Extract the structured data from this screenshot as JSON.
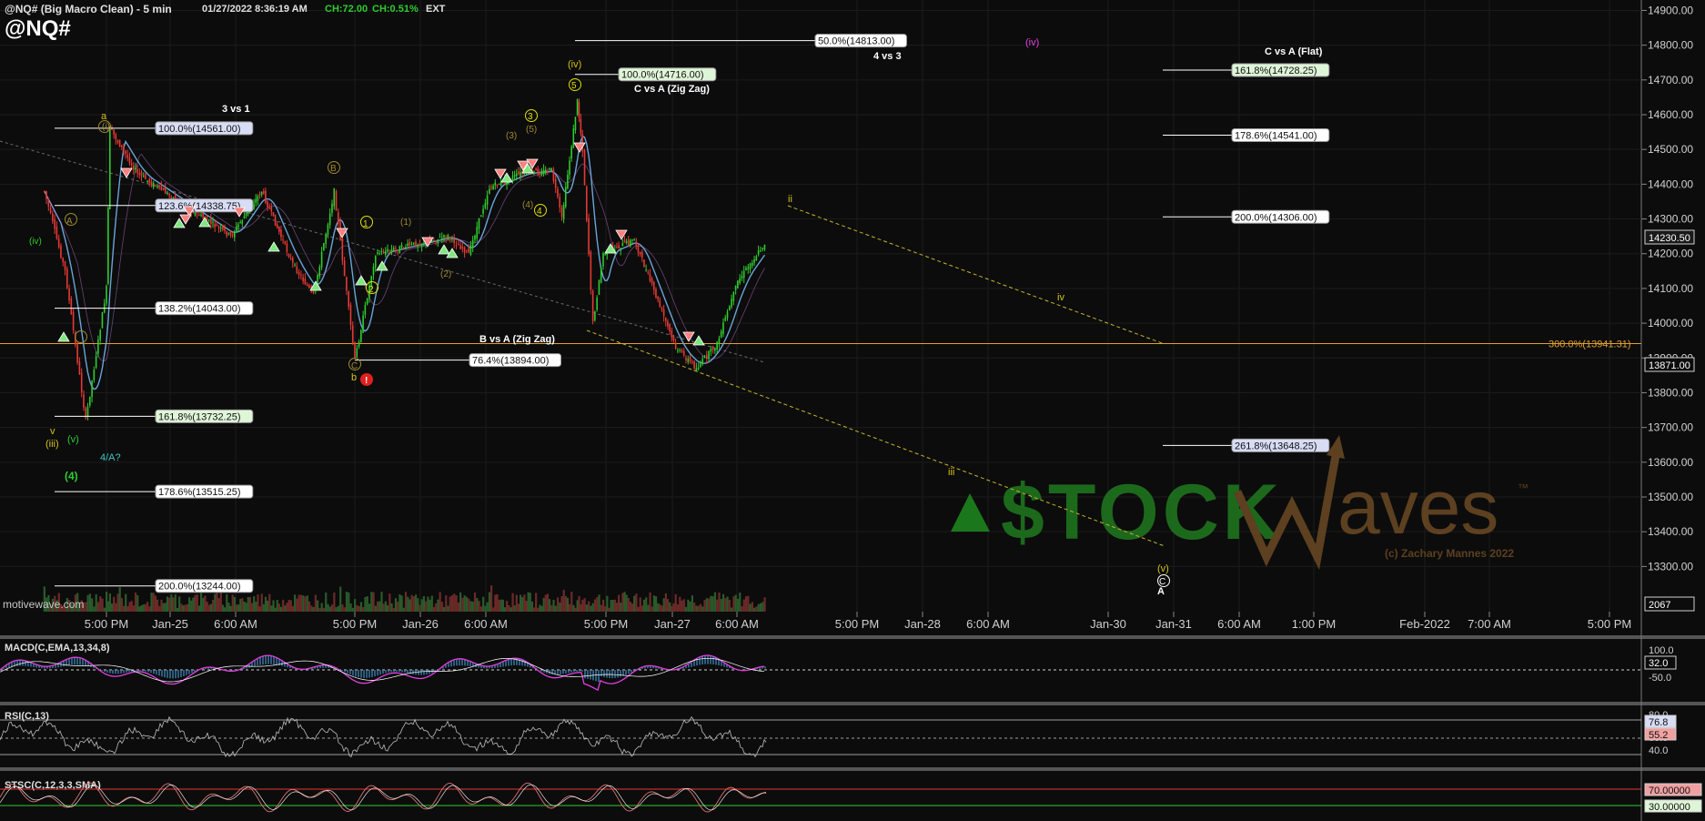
{
  "header": {
    "symbol_desc": "@NQ# (Big Macro Clean) - 5 min",
    "timestamp": "01/27/2022 8:36:19 AM",
    "ch": "CH:72.00",
    "ch_pct": "CH:0.51%",
    "session": "EXT",
    "symbol": "@NQ#"
  },
  "footer_text": "motivewave.com",
  "logo": {
    "text": "STOCKWaves",
    "tm": "™",
    "copyright": "(c) Zachary Mannes 2022"
  },
  "colors": {
    "background": "#0c0c0c",
    "up": "#2ecc2e",
    "down": "#e53935",
    "fib_box": "#ffffff",
    "orange_line": "#e0a030",
    "yellow_wave": "#d4c21a",
    "magenta": "#e040e0"
  },
  "chart_data": [
    {
      "type": "line",
      "title": "@NQ# 5 min",
      "y_axis_ticks": [
        "14900.00",
        "14800.00",
        "14700.00",
        "14600.00",
        "14500.00",
        "14400.00",
        "14300.00",
        "14200.00",
        "14100.00",
        "14000.00",
        "13900.00",
        "13800.00",
        "13700.00",
        "13600.00",
        "13500.00",
        "13400.00",
        "13300.00"
      ],
      "ylim": [
        13170,
        14930
      ],
      "price_tags": [
        "14230.50",
        "13871.00",
        "2067"
      ],
      "x_axis_ticks": [
        "5:00 PM",
        "Jan-25",
        "6:00 AM",
        "5:00 PM",
        "Jan-26",
        "6:00 AM",
        "5:00 PM",
        "Jan-27",
        "6:00 AM",
        "5:00 PM",
        "Jan-28",
        "6:00 AM",
        "Jan-30",
        "Jan-31",
        "6:00 AM",
        "1:00 PM",
        "Feb-2022",
        "7:00 AM",
        "5:00 PM"
      ],
      "price_path": [
        {
          "x": "Jan-24 11:00 AM",
          "y": 14380
        },
        {
          "x": "Jan-24 1:00 PM",
          "y": 14150
        },
        {
          "x": "Jan-24 3:00 PM",
          "y": 13720
        },
        {
          "x": "Jan-24 5:00 PM",
          "y": 14100
        },
        {
          "x": "Jan-24 5:20 PM",
          "y": 14560
        },
        {
          "x": "Jan-24 8:00 PM",
          "y": 14430
        },
        {
          "x": "Jan-25 1:00 AM",
          "y": 14330
        },
        {
          "x": "Jan-25 5:00 AM",
          "y": 14250
        },
        {
          "x": "Jan-25 8:00 AM",
          "y": 14380
        },
        {
          "x": "Jan-25 11:00 AM",
          "y": 14170
        },
        {
          "x": "Jan-25 1:00 PM",
          "y": 14080
        },
        {
          "x": "Jan-25 3:00 PM",
          "y": 14380
        },
        {
          "x": "Jan-25 5:00 PM",
          "y": 13894
        },
        {
          "x": "Jan-25 7:00 PM",
          "y": 14200
        },
        {
          "x": "Jan-26 2:00 AM",
          "y": 14250
        },
        {
          "x": "Jan-26 4:00 AM",
          "y": 14200
        },
        {
          "x": "Jan-26 6:00 AM",
          "y": 14390
        },
        {
          "x": "Jan-26 9:00 AM",
          "y": 14430
        },
        {
          "x": "Jan-26 12:00 PM",
          "y": 14440
        },
        {
          "x": "Jan-26 1:00 PM",
          "y": 14300
        },
        {
          "x": "Jan-26 2:30 PM",
          "y": 14640
        },
        {
          "x": "Jan-26 3:00 PM",
          "y": 14500
        },
        {
          "x": "Jan-26 4:00 PM",
          "y": 14000
        },
        {
          "x": "Jan-26 5:00 PM",
          "y": 14200
        },
        {
          "x": "Jan-26 8:00 PM",
          "y": 14240
        },
        {
          "x": "Jan-27 12:00 AM",
          "y": 13930
        },
        {
          "x": "Jan-27 2:00 AM",
          "y": 13870
        },
        {
          "x": "Jan-27 4:00 AM",
          "y": 13940
        },
        {
          "x": "Jan-27 6:00 AM",
          "y": 14120
        },
        {
          "x": "Jan-27 8:36 AM",
          "y": 14230
        }
      ],
      "fib_levels": [
        {
          "label": "50.0%(14813.00)",
          "value": 14813
        },
        {
          "label": "100.0%(14716.00)",
          "value": 14716
        },
        {
          "label": "100.0%(14561.00)",
          "value": 14561
        },
        {
          "label": "123.6%(14338.75)",
          "value": 14338.75
        },
        {
          "label": "138.2%(14043.00)",
          "value": 14043
        },
        {
          "label": "76.4%(13894.00)",
          "value": 13894
        },
        {
          "label": "161.8%(13732.25)",
          "value": 13732.25
        },
        {
          "label": "178.6%(13515.25)",
          "value": 13515.25
        },
        {
          "label": "200.0%(13244.00)",
          "value": 13244
        },
        {
          "label": "161.8%(14728.25)",
          "value": 14728.25
        },
        {
          "label": "178.6%(14541.00)",
          "value": 14541
        },
        {
          "label": "200.0%(14306.00)",
          "value": 14306
        },
        {
          "label": "261.8%(13648.25)",
          "value": 13648.25
        },
        {
          "label": "300.0%(13941.31)",
          "value": 13941.31
        }
      ],
      "annotations": [
        "3 vs 1",
        "C vs A (Zig Zag)",
        "4 vs 3",
        "C vs A (Flat)",
        "B vs A (Zig Zag)",
        "4/A?",
        "a",
        "b",
        "v",
        "(iii)",
        "(v)",
        "(iv)",
        "(4)",
        "ii",
        "iii",
        "iv",
        "(v)",
        "A",
        "C",
        "(iv)",
        "1",
        "2",
        "3",
        "4",
        "5",
        "(1)",
        "(2)",
        "(3)",
        "(4)",
        "(5)",
        "A",
        "B",
        "C",
        "(iv)",
        "(i)"
      ]
    },
    {
      "type": "line",
      "title": "MACD(C,EMA,13,34,8)",
      "y_axis_ticks": [
        "100.0",
        "0.0",
        "-50.0"
      ],
      "value_tag": "32.0"
    },
    {
      "type": "line",
      "title": "RSI(C,13)",
      "y_axis_ticks": [
        "80.0",
        "60.0",
        "40.0"
      ],
      "value_tags": [
        "76.8",
        "55.2"
      ]
    },
    {
      "type": "line",
      "title": "STSC(C,12,3,3,SMA)",
      "value_tags": [
        "70.00000",
        "30.00000"
      ]
    }
  ]
}
